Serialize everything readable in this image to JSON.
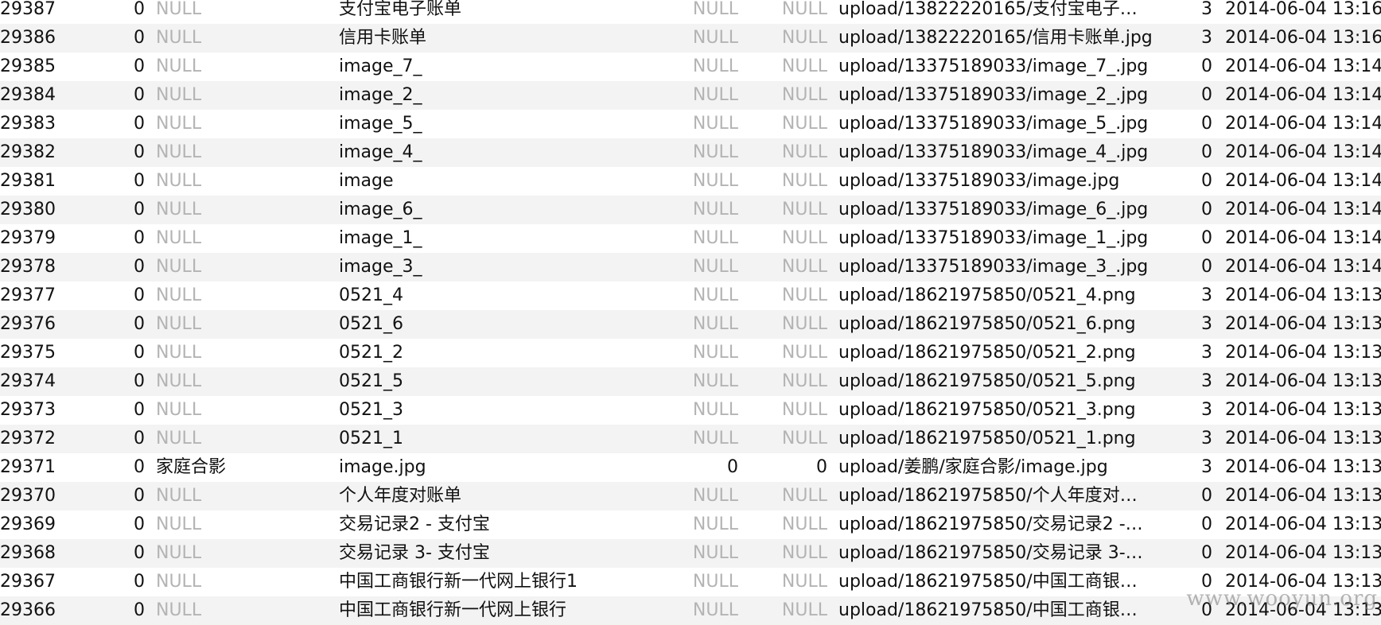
{
  "table": {
    "null_text": "NULL",
    "rows": [
      {
        "id": "29387",
        "flag": "0",
        "album": "NULL",
        "name": "支付宝电子账单",
        "n1": "NULL",
        "n2": "NULL",
        "path": "upload/13822220165/支付宝电子…",
        "type": "3",
        "date": "2014-06-04 13:16"
      },
      {
        "id": "29386",
        "flag": "0",
        "album": "NULL",
        "name": "信用卡账单",
        "n1": "NULL",
        "n2": "NULL",
        "path": "upload/13822220165/信用卡账单.jpg",
        "type": "3",
        "date": "2014-06-04 13:16"
      },
      {
        "id": "29385",
        "flag": "0",
        "album": "NULL",
        "name": "image_7_",
        "n1": "NULL",
        "n2": "NULL",
        "path": "upload/13375189033/image_7_.jpg",
        "type": "0",
        "date": "2014-06-04 13:14"
      },
      {
        "id": "29384",
        "flag": "0",
        "album": "NULL",
        "name": "image_2_",
        "n1": "NULL",
        "n2": "NULL",
        "path": "upload/13375189033/image_2_.jpg",
        "type": "0",
        "date": "2014-06-04 13:14"
      },
      {
        "id": "29383",
        "flag": "0",
        "album": "NULL",
        "name": "image_5_",
        "n1": "NULL",
        "n2": "NULL",
        "path": "upload/13375189033/image_5_.jpg",
        "type": "0",
        "date": "2014-06-04 13:14"
      },
      {
        "id": "29382",
        "flag": "0",
        "album": "NULL",
        "name": "image_4_",
        "n1": "NULL",
        "n2": "NULL",
        "path": "upload/13375189033/image_4_.jpg",
        "type": "0",
        "date": "2014-06-04 13:14"
      },
      {
        "id": "29381",
        "flag": "0",
        "album": "NULL",
        "name": "image",
        "n1": "NULL",
        "n2": "NULL",
        "path": "upload/13375189033/image.jpg",
        "type": "0",
        "date": "2014-06-04 13:14"
      },
      {
        "id": "29380",
        "flag": "0",
        "album": "NULL",
        "name": "image_6_",
        "n1": "NULL",
        "n2": "NULL",
        "path": "upload/13375189033/image_6_.jpg",
        "type": "0",
        "date": "2014-06-04 13:14"
      },
      {
        "id": "29379",
        "flag": "0",
        "album": "NULL",
        "name": "image_1_",
        "n1": "NULL",
        "n2": "NULL",
        "path": "upload/13375189033/image_1_.jpg",
        "type": "0",
        "date": "2014-06-04 13:14"
      },
      {
        "id": "29378",
        "flag": "0",
        "album": "NULL",
        "name": "image_3_",
        "n1": "NULL",
        "n2": "NULL",
        "path": "upload/13375189033/image_3_.jpg",
        "type": "0",
        "date": "2014-06-04 13:14"
      },
      {
        "id": "29377",
        "flag": "0",
        "album": "NULL",
        "name": "0521_4",
        "n1": "NULL",
        "n2": "NULL",
        "path": "upload/18621975850/0521_4.png",
        "type": "3",
        "date": "2014-06-04 13:13"
      },
      {
        "id": "29376",
        "flag": "0",
        "album": "NULL",
        "name": "0521_6",
        "n1": "NULL",
        "n2": "NULL",
        "path": "upload/18621975850/0521_6.png",
        "type": "3",
        "date": "2014-06-04 13:13"
      },
      {
        "id": "29375",
        "flag": "0",
        "album": "NULL",
        "name": "0521_2",
        "n1": "NULL",
        "n2": "NULL",
        "path": "upload/18621975850/0521_2.png",
        "type": "3",
        "date": "2014-06-04 13:13"
      },
      {
        "id": "29374",
        "flag": "0",
        "album": "NULL",
        "name": "0521_5",
        "n1": "NULL",
        "n2": "NULL",
        "path": "upload/18621975850/0521_5.png",
        "type": "3",
        "date": "2014-06-04 13:13"
      },
      {
        "id": "29373",
        "flag": "0",
        "album": "NULL",
        "name": "0521_3",
        "n1": "NULL",
        "n2": "NULL",
        "path": "upload/18621975850/0521_3.png",
        "type": "3",
        "date": "2014-06-04 13:13"
      },
      {
        "id": "29372",
        "flag": "0",
        "album": "NULL",
        "name": "0521_1",
        "n1": "NULL",
        "n2": "NULL",
        "path": "upload/18621975850/0521_1.png",
        "type": "3",
        "date": "2014-06-04 13:13"
      },
      {
        "id": "29371",
        "flag": "0",
        "album": "家庭合影",
        "name": "image.jpg",
        "n1": "0",
        "n2": "0",
        "path": "upload/姜鹏/家庭合影/image.jpg",
        "type": "3",
        "date": "2014-06-04 13:13"
      },
      {
        "id": "29370",
        "flag": "0",
        "album": "NULL",
        "name": "个人年度对账单",
        "n1": "NULL",
        "n2": "NULL",
        "path": "upload/18621975850/个人年度对…",
        "type": "0",
        "date": "2014-06-04 13:13"
      },
      {
        "id": "29369",
        "flag": "0",
        "album": "NULL",
        "name": "交易记录2 - 支付宝",
        "n1": "NULL",
        "n2": "NULL",
        "path": "upload/18621975850/交易记录2 -…",
        "type": "0",
        "date": "2014-06-04 13:13"
      },
      {
        "id": "29368",
        "flag": "0",
        "album": "NULL",
        "name": "交易记录 3- 支付宝",
        "n1": "NULL",
        "n2": "NULL",
        "path": "upload/18621975850/交易记录 3-…",
        "type": "0",
        "date": "2014-06-04 13:13"
      },
      {
        "id": "29367",
        "flag": "0",
        "album": "NULL",
        "name": "中国工商银行新一代网上银行1",
        "n1": "NULL",
        "n2": "NULL",
        "path": "upload/18621975850/中国工商银…",
        "type": "0",
        "date": "2014-06-04 13:13"
      },
      {
        "id": "29366",
        "flag": "0",
        "album": "NULL",
        "name": "中国工商银行新一代网上银行",
        "n1": "NULL",
        "n2": "NULL",
        "path": "upload/18621975850/中国工商银…",
        "type": "0",
        "date": "2014-06-04 13:13"
      }
    ]
  },
  "watermark": "www.wooyun.org"
}
